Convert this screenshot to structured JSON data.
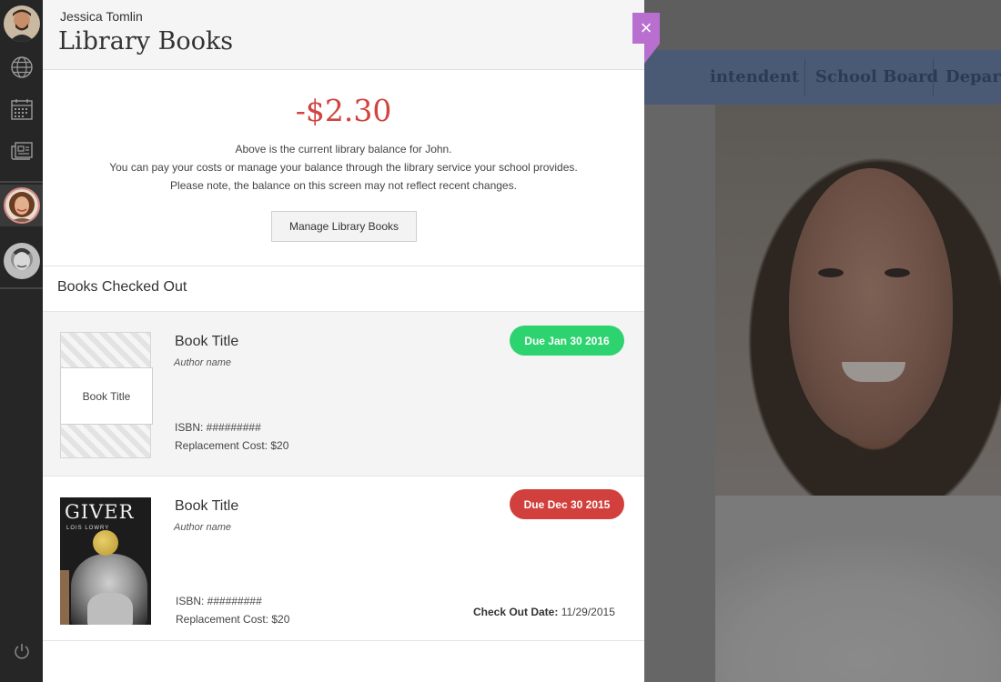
{
  "background": {
    "nav_items": [
      "intendent",
      "School Board",
      "Depart"
    ]
  },
  "sidebar": {
    "items": [
      {
        "name": "user-avatar-male",
        "icon": "avatar"
      },
      {
        "name": "globe",
        "icon": "globe-icon"
      },
      {
        "name": "calendar",
        "icon": "calendar-icon"
      },
      {
        "name": "news",
        "icon": "news-icon"
      },
      {
        "name": "student-avatar-female",
        "icon": "avatar"
      },
      {
        "name": "student-avatar-male",
        "icon": "avatar"
      },
      {
        "name": "power",
        "icon": "power-icon"
      }
    ]
  },
  "panel": {
    "user_name": "Jessica Tomlin",
    "title": "Library Books",
    "close_label": "×",
    "balance": {
      "amount": "-$2.30",
      "line1": "Above is the current library balance for John.",
      "line2": "You can pay your costs or manage your balance through the library service your school provides.",
      "line3": "Please note, the balance on this screen may not reflect recent changes.",
      "button": "Manage Library Books"
    },
    "section_title": "Books Checked Out",
    "books": [
      {
        "cover_label": "Book Title",
        "title": "Book Title",
        "author": "Author name",
        "isbn": "ISBN: #########",
        "replacement": "Replacement Cost: $20",
        "due": "Due Jan 30 2016",
        "due_color": "#2dd36f"
      },
      {
        "cover_title": "GIVER",
        "cover_author": "LOIS LOWRY",
        "title": "Book Title",
        "author": "Author name",
        "isbn": "ISBN: #########",
        "replacement": "Replacement Cost: $20",
        "due": "Due Dec 30 2015",
        "due_color": "#d1403c",
        "checkout_label": "Check Out Date:",
        "checkout_date": "11/29/2015"
      }
    ]
  },
  "colors": {
    "accent_close": "#b96fcf",
    "balance_negative": "#d1443f",
    "due_ok": "#2dd36f",
    "due_overdue": "#d1403c"
  }
}
